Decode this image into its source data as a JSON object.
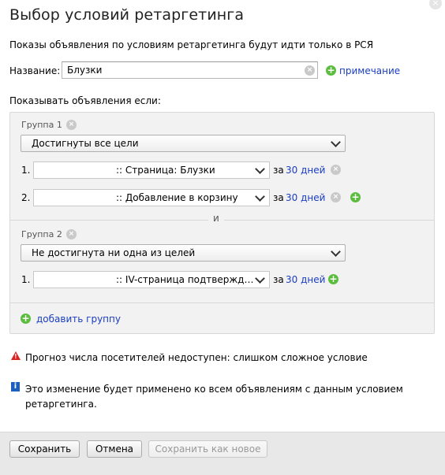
{
  "dialog": {
    "title": "Выбор условий ретаргетинга",
    "subtitle": "Показы объявления по условиям ретаргетинга будут идти только в РСЯ",
    "name_label": "Название:",
    "name_value": "Блузки",
    "note_link": "примечание",
    "show_if_label": "Показывать объявления если:"
  },
  "groups": [
    {
      "label": "Группа 1",
      "mode": "Достигнуты все цели",
      "conditions": [
        {
          "num": "1.",
          "goal": ":: Страница: Блузки",
          "period_prefix": "за",
          "period": "30 дней"
        },
        {
          "num": "2.",
          "goal": ":: Добавление в корзину",
          "period_prefix": "за",
          "period": "30 дней"
        }
      ]
    },
    {
      "label": "Группа 2",
      "mode": "Не достигнута ни одна из целей",
      "conditions": [
        {
          "num": "1.",
          "goal": ":: IV-страница подтвержд…",
          "period_prefix": "за",
          "period": "30 дней"
        }
      ]
    }
  ],
  "and_label": "и",
  "add_group_label": "добавить группу",
  "warning": "Прогноз числа посетителей недоступен: слишком сложное условие",
  "info": "Это изменение будет применено ко всем объявлениям с данным условием ретаргетинга.",
  "footer": {
    "save": "Сохранить",
    "cancel": "Отмена",
    "save_as_new": "Сохранить как новое"
  },
  "colors": {
    "link": "#1a3dc1",
    "plus": "#5bbd3d",
    "warning": "#dd2222",
    "info": "#1c5fbf"
  }
}
